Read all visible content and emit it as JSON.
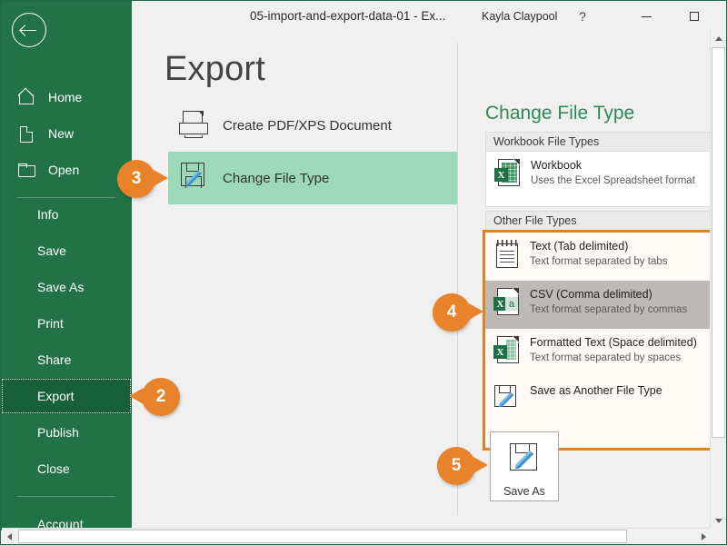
{
  "window": {
    "title": "05-import-and-export-data-01  -  Ex...",
    "account_name": "Kayla Claypool",
    "help_label": "?",
    "minimize_label": "",
    "maximize_label": "",
    "close_label": ""
  },
  "sidebar": {
    "back_label": "",
    "top_items": [
      {
        "label": "Home",
        "icon": "home-icon"
      },
      {
        "label": "New",
        "icon": "new-document-icon"
      },
      {
        "label": "Open",
        "icon": "open-folder-icon"
      }
    ],
    "sub_items": [
      {
        "label": "Info",
        "selected": false
      },
      {
        "label": "Save",
        "selected": false
      },
      {
        "label": "Save As",
        "selected": false
      },
      {
        "label": "Print",
        "selected": false
      },
      {
        "label": "Share",
        "selected": false
      },
      {
        "label": "Export",
        "selected": true
      },
      {
        "label": "Publish",
        "selected": false
      },
      {
        "label": "Close",
        "selected": false
      }
    ],
    "account_item": {
      "label": "Account"
    }
  },
  "main": {
    "page_title": "Export",
    "options": [
      {
        "label": "Create PDF/XPS Document",
        "icon": "printer-document-icon",
        "active": false
      },
      {
        "label": "Change File Type",
        "icon": "save-pencil-icon",
        "active": true
      }
    ]
  },
  "right_panel": {
    "title": "Change File Type",
    "groups": [
      {
        "header": "Workbook File Types",
        "highlighted": false,
        "items": [
          {
            "name": "Workbook",
            "desc": "Uses the Excel Spreadsheet format",
            "icon": "excel-workbook-icon",
            "selected": false
          }
        ]
      },
      {
        "header": "Other File Types",
        "highlighted": true,
        "items": [
          {
            "name": "Text (Tab delimited)",
            "desc": "Text format separated by tabs",
            "icon": "notepad-icon",
            "selected": false
          },
          {
            "name": "CSV (Comma delimited)",
            "desc": "Text format separated by commas",
            "icon": "excel-csv-icon",
            "selected": true
          },
          {
            "name": "Formatted Text (Space delimited)",
            "desc": "Text format separated by spaces",
            "icon": "excel-formatted-text-icon",
            "selected": false
          },
          {
            "name": "Save as Another File Type",
            "desc": "",
            "icon": "save-pencil-icon",
            "selected": false
          }
        ]
      }
    ],
    "save_as_button": {
      "label": "Save As",
      "icon": "save-pencil-icon"
    }
  },
  "callouts": [
    {
      "number": "2",
      "points": "left",
      "target": "sidebar-item-export"
    },
    {
      "number": "3",
      "points": "right",
      "target": "option-change-file-type"
    },
    {
      "number": "4",
      "points": "right",
      "target": "other-file-types-box"
    },
    {
      "number": "5",
      "points": "right",
      "target": "save-as-button"
    }
  ],
  "colors": {
    "brand_green": "#217346",
    "selected_green": "#186038",
    "mint_highlight": "#9cd9b9",
    "callout_orange": "#e8822b",
    "panel_title_green": "#2e8b57",
    "row_selected_gray": "#bdb9b6"
  }
}
